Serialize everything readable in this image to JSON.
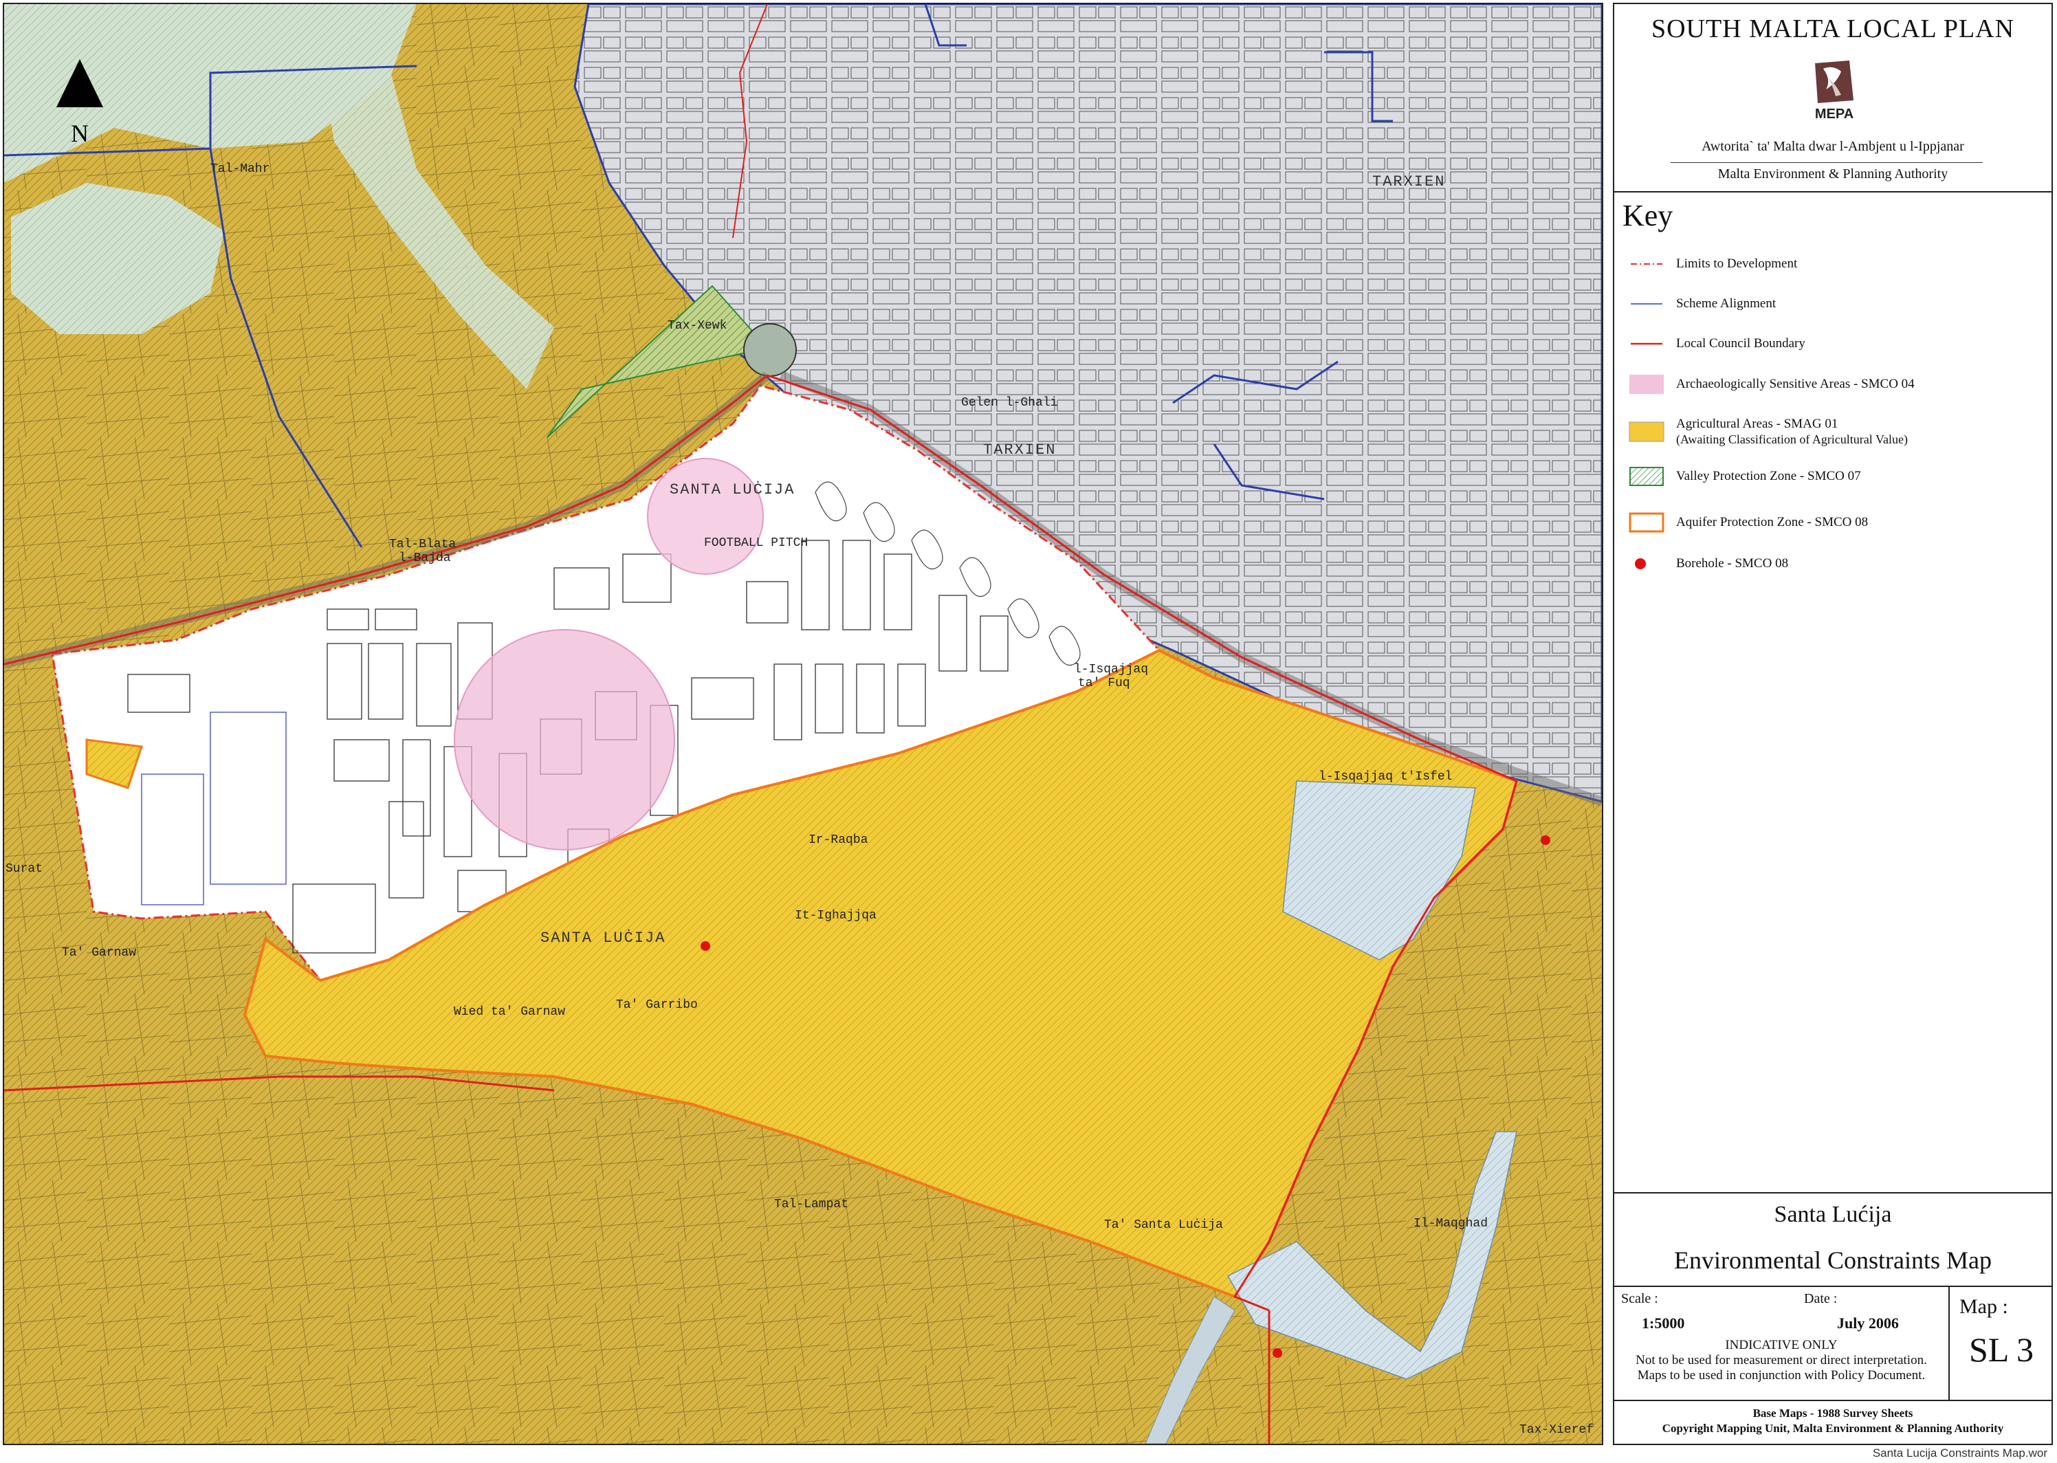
{
  "panel": {
    "title": "SOUTH MALTA LOCAL PLAN",
    "logo_text": "MEPA",
    "authority_mt": "Awtorita` ta' Malta dwar l-Ambjent u l-Ippjanar",
    "authority_en": "Malta Environment & Planning Authority",
    "key_title": "Key",
    "key": [
      {
        "label": "Limits to Development",
        "symbol": "dashdot-red-line",
        "color": "#e8312f"
      },
      {
        "label": "Scheme Alignment",
        "symbol": "blue-line",
        "color": "#5a6fd6"
      },
      {
        "label": "Local Council Boundary",
        "symbol": "red-line",
        "color": "#e0201c"
      },
      {
        "label": "Archaeologically Sensitive Areas - SMCO 04",
        "symbol": "pink-fill",
        "color": "#f3c2dc"
      },
      {
        "label": "Agricultural Areas - SMAG 01",
        "sublabel": "(Awaiting Classification of Agricultural Value)",
        "symbol": "yellow-fill",
        "color": "#f4c93a"
      },
      {
        "label": "Valley Protection Zone - SMCO 07",
        "symbol": "green-hatch",
        "color": "#2e8b3a"
      },
      {
        "label": "Aquifer Protection Zone - SMCO 08",
        "symbol": "orange-outline",
        "color": "#f07a1a"
      },
      {
        "label": "Borehole - SMCO 08",
        "symbol": "red-dot",
        "color": "#e01010"
      }
    ],
    "place_name": "Santa Lućija",
    "map_name": "Environmental Constraints Map",
    "scale_label": "Scale :",
    "scale_value": "1:5000",
    "date_label": "Date :",
    "date_value": "July 2006",
    "map_label": "Map :",
    "map_number": "SL 3",
    "notes": [
      "INDICATIVE ONLY",
      "Not to be used for measurement or direct interpretation.",
      "Maps to be used in conjunction with Policy Document."
    ],
    "footer": [
      "Base Maps - 1988 Survey Sheets",
      "Copyright Mapping Unit, Malta Environment & Planning Authority"
    ]
  },
  "map": {
    "north_label": "N",
    "labels": {
      "tal_mahr": "Tal-Mahr",
      "tax_xewk": "Tax-Xewk",
      "tal_blata": "Tal-Blata",
      "l_bajda": "l-Bajda",
      "santa_lucija_top": "SANTA LUĊIJA",
      "santa_lucija_bottom": "SANTA LUĊIJA",
      "tarxien_1": "TARXIEN",
      "tarxien_2": "TARXIEN",
      "gelen": "Gelen l-Ghali",
      "isqajjaq": "l-Isqajjaq",
      "ta_fuq": "ta' Fuq",
      "isqajjaq_isfel": "l-Isqajjaq t'Isfel",
      "ir_raqba": "Ir-Raqba",
      "it_ighajjqa": "It-Ighajjqa",
      "ta_garnaw": "Ta' Garnaw",
      "wied_ta_garnaw": "Wied ta' Garnaw",
      "ta_garribo": "Ta' Garribo",
      "tal_lampat": "Tal-Lampat",
      "ta_santa_lucija": "Ta' Santa Luċija",
      "il_maqghad": "Il-Maqghad",
      "tax_xieref": "Tax-Xieref",
      "surat": "Surat",
      "football": "FOOTBALL PITCH"
    }
  },
  "filename": "Santa Lucija Constraints Map.wor"
}
